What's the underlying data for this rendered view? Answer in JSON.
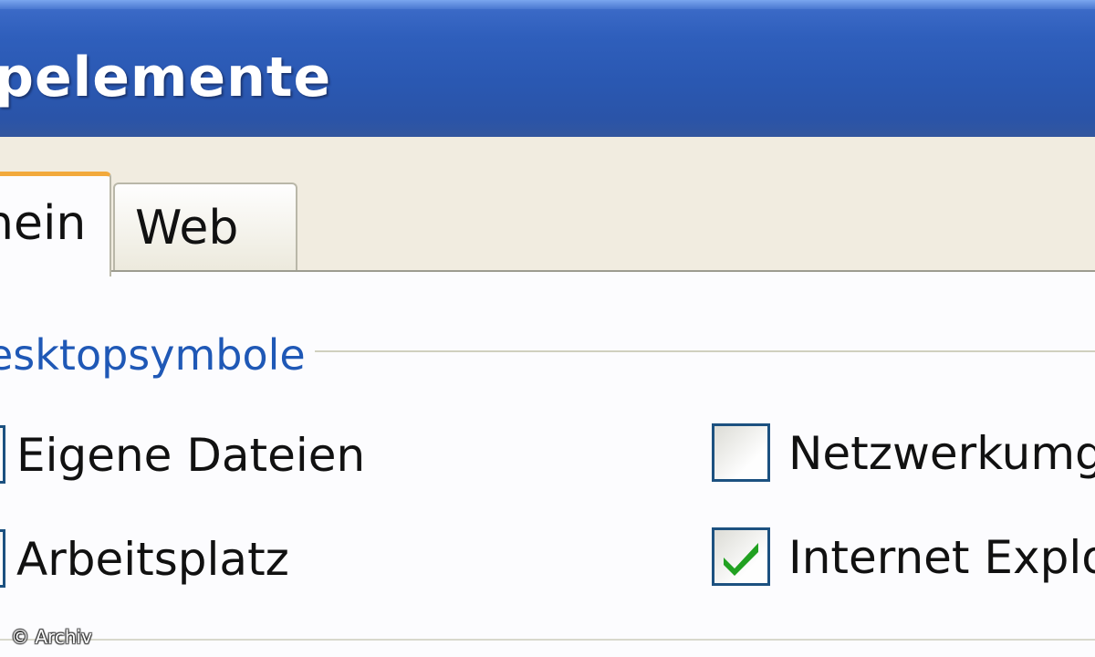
{
  "window": {
    "title": "pelemente"
  },
  "tabs": [
    {
      "label": "hein",
      "active": true
    },
    {
      "label": "Web",
      "active": false
    }
  ],
  "group": {
    "label": "esktopsymbole"
  },
  "checkboxes": [
    {
      "label": "Eigene Dateien",
      "checked": false
    },
    {
      "label": "Arbeitsplatz",
      "checked": false
    },
    {
      "label": "Netzwerkumg",
      "checked": false
    },
    {
      "label": "Internet Explo",
      "checked": true
    }
  ],
  "watermark": "© Archiv",
  "colors": {
    "titlebar": "#2f5fbc",
    "tab_highlight": "#f2a93c",
    "group_label": "#1f58b6",
    "checkmark": "#21a121",
    "checkbox_border": "#1c5180"
  }
}
